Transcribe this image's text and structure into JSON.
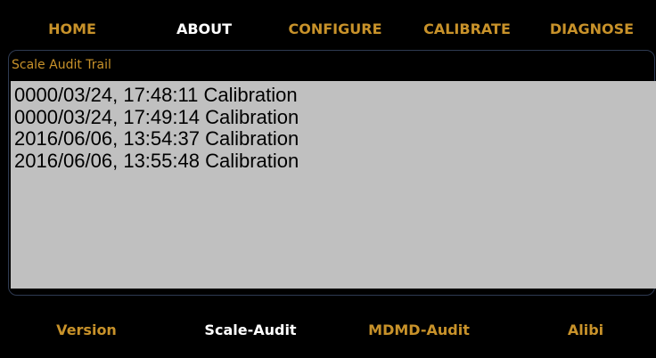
{
  "nav": {
    "tabs": [
      {
        "label": "HOME"
      },
      {
        "label": "ABOUT"
      },
      {
        "label": "CONFIGURE"
      },
      {
        "label": "CALIBRATE"
      },
      {
        "label": "DIAGNOSE"
      }
    ]
  },
  "panel": {
    "title": "Scale Audit Trail",
    "entries": [
      "0000/03/24, 17:48:11 Calibration",
      "0000/03/24, 17:49:14 Calibration",
      "2016/06/06, 13:54:37 Calibration",
      "2016/06/06, 13:55:48 Calibration"
    ]
  },
  "subnav": {
    "tabs": [
      {
        "label": "Version"
      },
      {
        "label": "Scale-Audit"
      },
      {
        "label": "MDMD-Audit"
      },
      {
        "label": "Alibi"
      }
    ]
  },
  "colors": {
    "accent": "#c8922a",
    "active": "#ffffff",
    "background": "#000000",
    "log_background": "#c0c0c0",
    "panel_border": "#2e3a52"
  }
}
